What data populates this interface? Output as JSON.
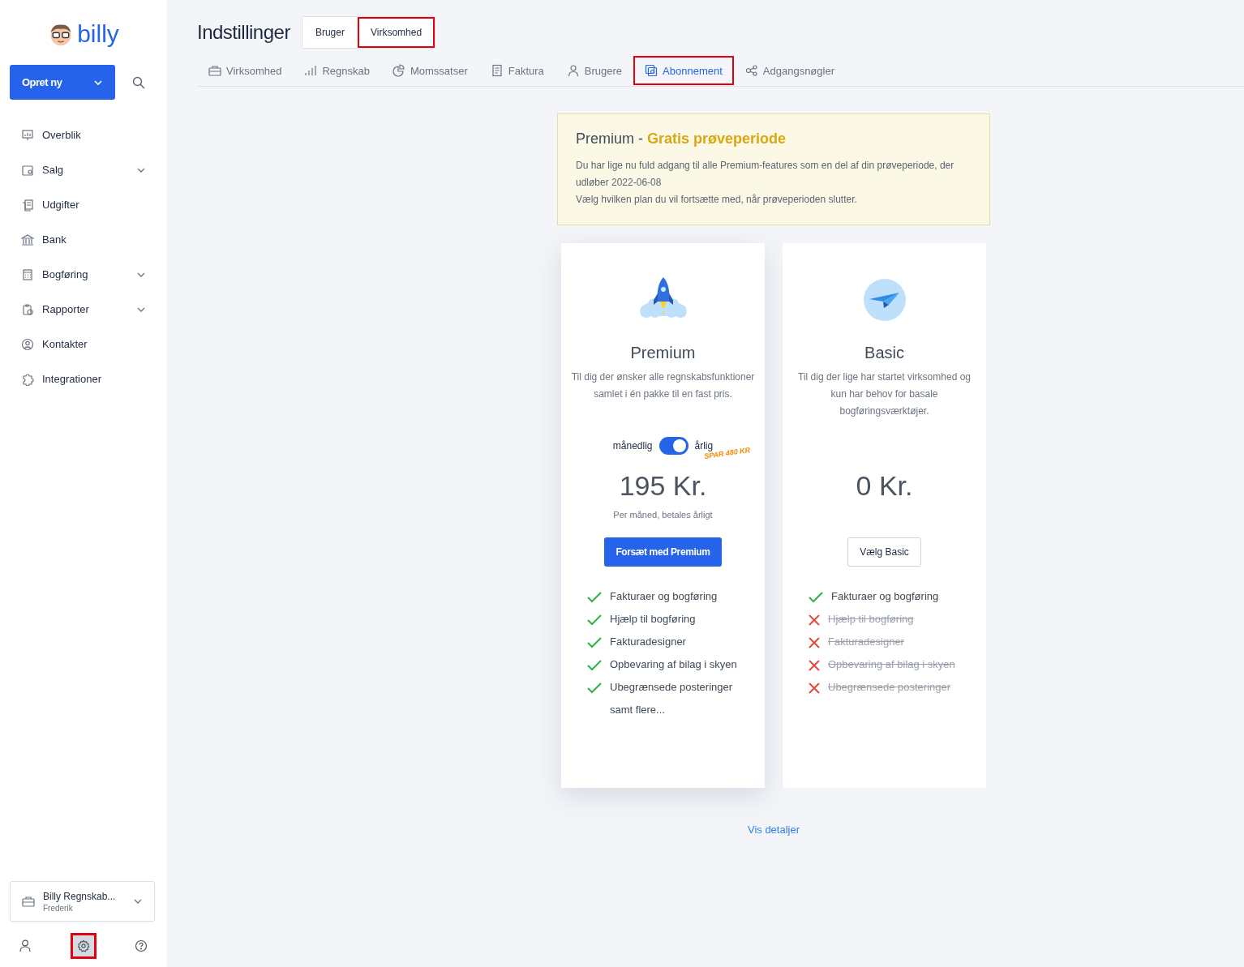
{
  "sidebar": {
    "logo": "billy",
    "create_button": "Opret ny",
    "items": [
      {
        "label": "Overblik",
        "expandable": false
      },
      {
        "label": "Salg",
        "expandable": true
      },
      {
        "label": "Udgifter",
        "expandable": false
      },
      {
        "label": "Bank",
        "expandable": false
      },
      {
        "label": "Bogføring",
        "expandable": true
      },
      {
        "label": "Rapporter",
        "expandable": true
      },
      {
        "label": "Kontakter",
        "expandable": false
      },
      {
        "label": "Integrationer",
        "expandable": false
      }
    ],
    "organization": {
      "name": "Billy Regnskab...",
      "user": "Frederik"
    },
    "footer_icons": [
      {
        "selected": false
      },
      {
        "selected": true
      },
      {
        "selected": false
      }
    ]
  },
  "header": {
    "title": "Indstillinger",
    "scope_tabs": [
      {
        "label": "Bruger",
        "selected": false
      },
      {
        "label": "Virksomhed",
        "selected": true
      }
    ]
  },
  "tabs": [
    {
      "label": "Virksomhed",
      "selected": false
    },
    {
      "label": "Regnskab",
      "selected": false
    },
    {
      "label": "Momssatser",
      "selected": false
    },
    {
      "label": "Faktura",
      "selected": false
    },
    {
      "label": "Brugere",
      "selected": false
    },
    {
      "label": "Abonnement",
      "selected": true
    },
    {
      "label": "Adgangsnøgler",
      "selected": false
    }
  ],
  "notice": {
    "plan": "Premium",
    "separator": "-",
    "highlight": "Gratis prøveperiode",
    "lines": [
      "Du har lige nu fuld adgang til alle Premium-features som en del af din prøveperiode, der udløber 2022-06-08",
      "Vælg hvilken plan du vil fortsætte med, når prøveperioden slutter."
    ]
  },
  "plans": [
    {
      "kind": "premium",
      "name": "Premium",
      "description": "Til dig der ønsker alle regnskabsfunktioner samlet i én pakke til en fast pris.",
      "billing": {
        "left": "månedlig",
        "right": "årlig",
        "on": true,
        "savings": "SPAR 480 KR"
      },
      "price": "195 Kr.",
      "price_note": "Per måned, betales årligt",
      "button": "Forsæt med Premium",
      "features": [
        {
          "label": "Fakturaer og bogføring",
          "included": true
        },
        {
          "label": "Hjælp til bogføring",
          "included": true
        },
        {
          "label": "Fakturadesigner",
          "included": true
        },
        {
          "label": "Opbevaring af bilag i skyen",
          "included": true
        },
        {
          "label": "Ubegrænsede posteringer",
          "included": true
        }
      ],
      "more": "samt flere..."
    },
    {
      "kind": "basic",
      "name": "Basic",
      "description": "Til dig der lige har startet virksomhed og kun har behov for basale bogføringsværktøjer.",
      "price": "0 Kr.",
      "button": "Vælg Basic",
      "features": [
        {
          "label": "Fakturaer og bogføring",
          "included": true
        },
        {
          "label": "Hjælp til bogføring",
          "included": false
        },
        {
          "label": "Fakturadesigner",
          "included": false
        },
        {
          "label": "Opbevaring af bilag i skyen",
          "included": false
        },
        {
          "label": "Ubegrænsede posteringer",
          "included": false
        }
      ]
    }
  ],
  "details_link": "Vis detaljer"
}
